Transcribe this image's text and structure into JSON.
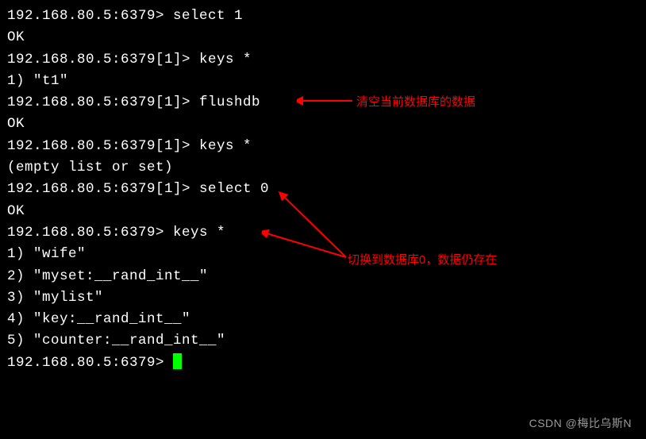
{
  "terminal": {
    "lines": [
      "192.168.80.5:6379> select 1",
      "OK",
      "192.168.80.5:6379[1]> keys *",
      "1) \"t1\"",
      "192.168.80.5:6379[1]> flushdb",
      "OK",
      "192.168.80.5:6379[1]> keys *",
      "(empty list or set)",
      "192.168.80.5:6379[1]> select 0",
      "OK",
      "192.168.80.5:6379> keys *",
      "1) \"wife\"",
      "2) \"myset:__rand_int__\"",
      "3) \"mylist\"",
      "4) \"key:__rand_int__\"",
      "5) \"counter:__rand_int__\"",
      "192.168.80.5:6379> "
    ]
  },
  "annotations": {
    "flushdb_note": "清空当前数据库的数据",
    "select0_note": "切换到数据库0，数据仍存在"
  },
  "watermark": "CSDN @梅比乌斯N"
}
